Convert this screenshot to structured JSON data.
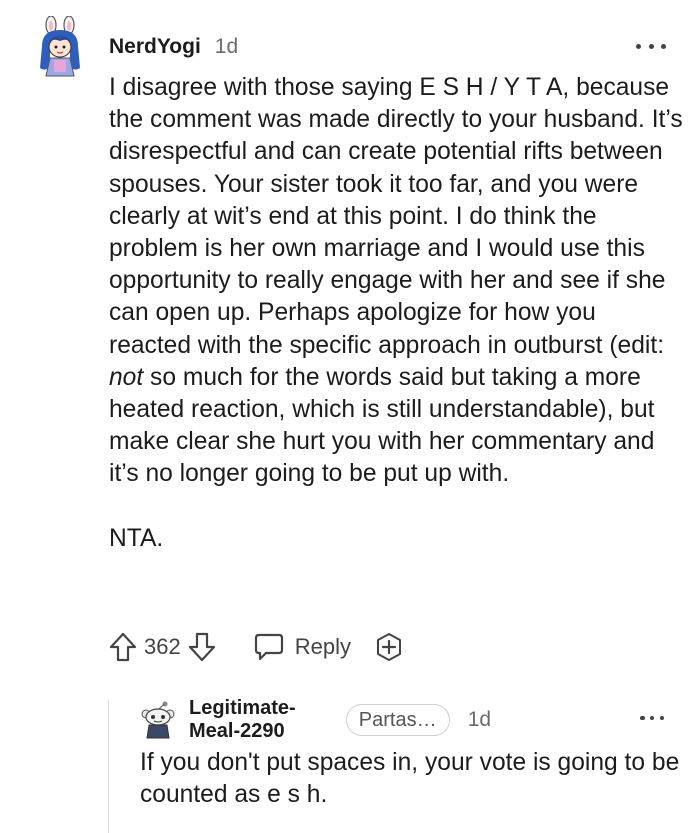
{
  "comment": {
    "author": "NerdYogi",
    "time": "1d",
    "avatar_icon": "bunny-ears-avatar-icon",
    "body": {
      "part1": "I disagree with those saying E S H / Y T A, because the comment was made directly to your husband. It’s disrespectful and can create potential rifts between spouses. Your sister took it too far, and you were clearly at wit’s end at this point. I do think the problem is her own marriage and I would use this opportunity to really engage with her and see if she can open up. Perhaps apologize for how you reacted with the specific approach in outburst (edit: ",
      "emphasis": "not",
      "part2": " so much for the words said but taking a more heated reaction, which is still understandable), but make clear she hurt you with her commentary and it’s no longer going to be put up with.",
      "verdict": "NTA."
    },
    "votes": "362",
    "reply_label": "Reply"
  },
  "reply": {
    "author": "Legitimate-Meal-2290",
    "flair": "Partassi...",
    "time": "1d",
    "avatar_icon": "snoo-avatar-icon",
    "text": "If you don't put spaces in, your vote is going to be counted as e s h."
  },
  "colors": {
    "text": "#1c1c1c",
    "meta": "#6b6b6b",
    "thread_line": "#dcdcdc"
  }
}
